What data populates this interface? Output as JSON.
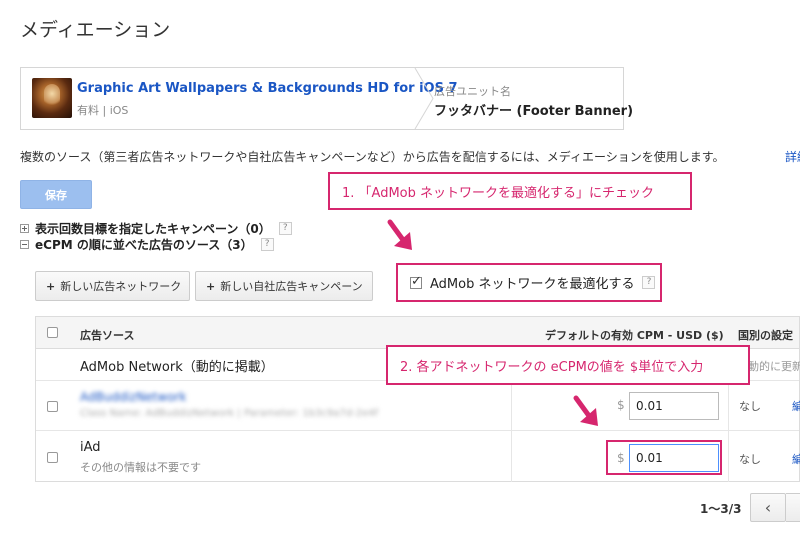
{
  "page": {
    "title": "メディエーション"
  },
  "app_card": {
    "app_name": "Graphic Art Wallpapers & Backgrounds HD for iOS 7",
    "app_meta": "有料 | iOS",
    "unit_label": "広告ユニット名",
    "unit_name": "フッタバナー (Footer Banner)"
  },
  "description": "複数のソース（第三者広告ネットワークや自社広告キャンペーンなど）から広告を配信するには、メディエーションを使用します。",
  "description_link": "詳細",
  "toolbar": {
    "save_label": "保存"
  },
  "annotations": {
    "step1": "1. 「AdMob ネットワークを最適化する」にチェック",
    "step2": "2. 各アドネットワークの eCPMの値を $単位で入力"
  },
  "sections": {
    "impression_campaigns": "表示回数目標を指定したキャンペーン（0）",
    "ecpm_sources": "eCPM の順に並べた広告のソース（3）",
    "help": "?"
  },
  "buttons": {
    "new_network": "新しい広告ネットワーク",
    "new_house": "新しい自社広告キャンペーン"
  },
  "optimize": {
    "label": "AdMob ネットワークを最適化する",
    "checked": true
  },
  "table": {
    "headers": {
      "source": "広告ソース",
      "ecpm": "デフォルトの有効 CPM - USD ($)",
      "country": "国別の設定"
    },
    "rows": [
      {
        "name": "AdMob Network（動的に掲載）",
        "sub": "",
        "currency": "",
        "ecpm": "",
        "country": "動的に更新",
        "edit": ""
      },
      {
        "name": "AdBuddizNetwork",
        "sub": "Class Name: AdBuddizNetwork | Parameter: 1b3c9a7d-2e4f",
        "currency": "$",
        "ecpm": "0.01",
        "country": "なし",
        "edit": "編集"
      },
      {
        "name": "iAd",
        "sub": "その他の情報は不要です",
        "currency": "$",
        "ecpm": "0.01",
        "country": "なし",
        "edit": "編集"
      }
    ]
  },
  "pagination": {
    "range": "1〜3/3",
    "prev": "‹"
  },
  "colors": {
    "accent": "#d6266e",
    "link": "#1a56c4",
    "save_button": "#9cbfef"
  }
}
